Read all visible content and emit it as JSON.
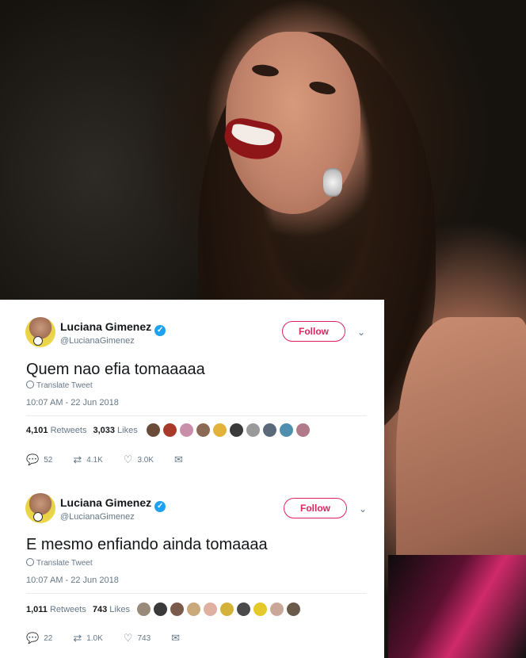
{
  "tweets": [
    {
      "display_name": "Luciana Gimenez",
      "handle": "@LucianaGimenez",
      "follow_label": "Follow",
      "text": "Quem nao efia tomaaaaa",
      "translate_label": "Translate Tweet",
      "timestamp": "10:07 AM - 22 Jun 2018",
      "retweets_count": "4,101",
      "retweets_label": "Retweets",
      "likes_count": "3,033",
      "likes_label": "Likes",
      "replies_count": "52",
      "retweet_action_count": "4.1K",
      "like_action_count": "3.0K"
    },
    {
      "display_name": "Luciana Gimenez",
      "handle": "@LucianaGimenez",
      "follow_label": "Follow",
      "text": "E mesmo enfiando ainda tomaaaa",
      "translate_label": "Translate Tweet",
      "timestamp": "10:07 AM - 22 Jun 2018",
      "retweets_count": "1,011",
      "retweets_label": "Retweets",
      "likes_count": "743",
      "likes_label": "Likes",
      "replies_count": "22",
      "retweet_action_count": "1.0K",
      "like_action_count": "743"
    }
  ],
  "colors": {
    "follow_accent": "#e0245e",
    "verified_badge": "#1da1f2",
    "muted_text": "#657786"
  },
  "icons": [
    "verified-icon",
    "chevron-down-icon",
    "globe-icon",
    "reply-icon",
    "retweet-icon",
    "like-icon",
    "message-icon"
  ]
}
